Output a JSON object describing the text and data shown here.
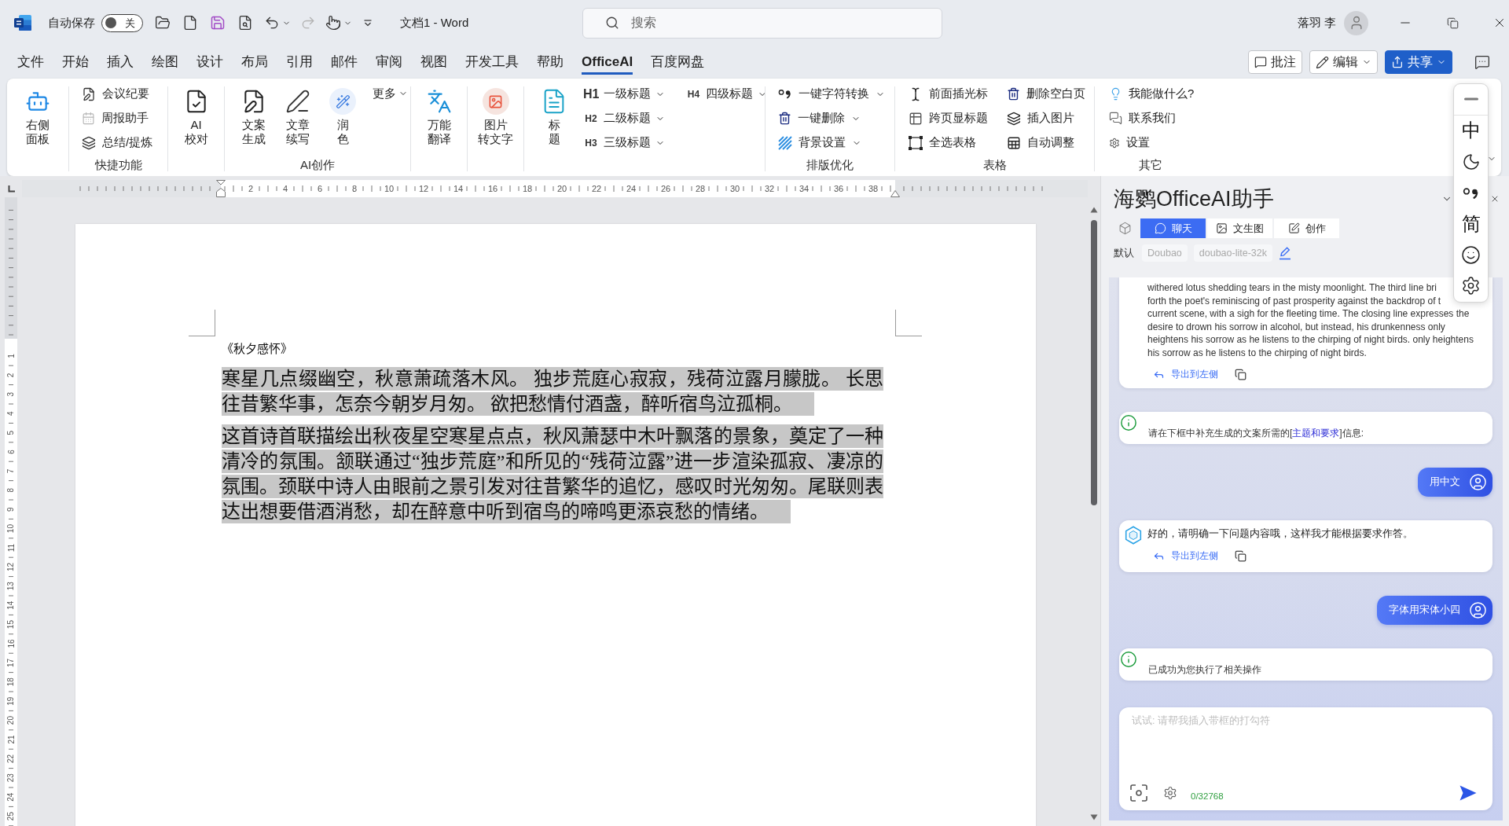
{
  "title_bar": {
    "autosave": {
      "label": "自动保存",
      "on": false,
      "state_label": "关"
    },
    "redo": {
      "disabled": true
    },
    "document_title": "文档1 - Word",
    "search": {
      "placeholder": "搜索"
    },
    "user_name": "落羽 李"
  },
  "tabs": [
    {
      "label": "文件",
      "selected": false
    },
    {
      "label": "开始",
      "selected": false
    },
    {
      "label": "插入",
      "selected": false
    },
    {
      "label": "绘图",
      "selected": false
    },
    {
      "label": "设计",
      "selected": false
    },
    {
      "label": "布局",
      "selected": false
    },
    {
      "label": "引用",
      "selected": false
    },
    {
      "label": "邮件",
      "selected": false
    },
    {
      "label": "审阅",
      "selected": false
    },
    {
      "label": "视图",
      "selected": false
    },
    {
      "label": "开发工具",
      "selected": false
    },
    {
      "label": "帮助",
      "selected": false
    },
    {
      "label": "OfficeAI",
      "selected": true
    },
    {
      "label": "百度网盘",
      "selected": false
    }
  ],
  "tab_actions": [
    {
      "kind": "comment",
      "label": "批注"
    },
    {
      "kind": "edit",
      "label": "编辑"
    },
    {
      "kind": "share",
      "label": "共享"
    }
  ],
  "ribbon": {
    "groups": [
      {
        "items": [
          {
            "kind": "large",
            "lines": [
              "右侧",
              "面板"
            ]
          }
        ]
      },
      {
        "label": "快捷功能",
        "items": [
          {
            "kind": "small",
            "label": "会议纪要"
          },
          {
            "kind": "small",
            "label": "周报助手"
          },
          {
            "kind": "small",
            "label": "总结/提炼"
          }
        ]
      },
      {
        "items": [
          {
            "kind": "large",
            "lines": [
              "AI",
              "校对"
            ]
          }
        ]
      },
      {
        "label": "AI创作",
        "items": [
          {
            "kind": "large",
            "lines": [
              "文案",
              "生成"
            ]
          },
          {
            "kind": "large",
            "lines": [
              "文章",
              "续写"
            ]
          },
          {
            "kind": "large",
            "lines": [
              "润",
              "色"
            ]
          },
          {
            "kind": "menu",
            "label": "更多"
          }
        ]
      },
      {
        "items": [
          {
            "kind": "large",
            "lines": [
              "万能",
              "翻译"
            ]
          }
        ]
      },
      {
        "items": [
          {
            "kind": "large",
            "lines": [
              "图片",
              "转文字"
            ]
          }
        ]
      },
      {
        "items": [
          {
            "kind": "large",
            "lines": [
              "标",
              "题"
            ]
          },
          {
            "kind": "heading",
            "prefix": "H1",
            "label": "一级标题"
          },
          {
            "kind": "heading",
            "prefix": "H2",
            "label": "二级标题"
          },
          {
            "kind": "heading",
            "prefix": "H3",
            "label": "三级标题"
          },
          {
            "kind": "heading",
            "prefix": "H4",
            "label": "四级标题"
          }
        ]
      },
      {
        "label": "排版优化",
        "items": [
          {
            "kind": "dropdown",
            "label": "一键字符转换"
          },
          {
            "kind": "dropdown",
            "label": "一键删除"
          },
          {
            "kind": "dropdown",
            "label": "背景设置"
          }
        ]
      },
      {
        "label": "表格",
        "items": [
          {
            "kind": "small",
            "label": "前面插光标"
          },
          {
            "kind": "small",
            "label": "跨页显标题"
          },
          {
            "kind": "small",
            "label": "全选表格"
          },
          {
            "kind": "small",
            "label": "删除空白页"
          },
          {
            "kind": "small",
            "label": "插入图片"
          },
          {
            "kind": "small",
            "label": "自动调整"
          }
        ]
      },
      {
        "label": "其它",
        "items": [
          {
            "kind": "small",
            "label": "我能做什么?"
          },
          {
            "kind": "small",
            "label": "联系我们"
          },
          {
            "kind": "small",
            "label": "设置"
          }
        ]
      }
    ]
  },
  "ruler": {
    "labels": [
      "2",
      "4",
      "6",
      "8",
      "10",
      "12",
      "14",
      "16",
      "18",
      "20",
      "22",
      "24",
      "26",
      "28",
      "30",
      "32",
      "34",
      "36",
      "38"
    ]
  },
  "vertical_ruler": {
    "labels": [
      "1",
      "2",
      "3",
      "4",
      "5",
      "6",
      "7",
      "8",
      "9",
      "10",
      "11",
      "12",
      "13",
      "14",
      "15",
      "16",
      "17",
      "18",
      "19",
      "20",
      "21",
      "22",
      "23",
      "24",
      "25"
    ]
  },
  "document": {
    "title": "《秋夕感怀》",
    "paragraphs": [
      {
        "text": "寒星几点缀幽空，秋意萧疏落木风。 独步荒庭心寂寂，残荷泣露月朦胧。 长思往昔繁华事，怎奈今朝岁月匆。 欲把愁情付酒盏，醉听宿鸟泣孤桐。",
        "selected": true
      },
      {
        "text": "这首诗首联描绘出秋夜星空寒星点点，秋风萧瑟中木叶飘落的景象，奠定了一种清冷的氛围。颔联通过“独步荒庭”和所见的“残荷泣露”进一步渲染孤寂、凄凉的氛围。颈联中诗人由眼前之景引发对往昔繁华的追忆，感叹时光匆匆。尾联则表达出想要借酒消愁，却在醉意中听到宿鸟的啼鸣更添哀愁的情绪。",
        "selected": true
      }
    ]
  },
  "assistant_panel": {
    "title": "海鹦OfficeAI助手",
    "tabs": [
      {
        "label": "聊天",
        "selected": true
      },
      {
        "label": "文生图",
        "selected": false
      },
      {
        "label": "创作",
        "selected": false
      }
    ],
    "model": {
      "label": "默认",
      "chips": [
        "Doubao",
        "doubao-lite-32k"
      ]
    },
    "messages": [
      {
        "kind": "answer-continued",
        "lines": [
          "withered lotus shedding tears in the misty moonlight. The third line bri",
          "forth the poet's reminiscing of past prosperity against the backdrop of t",
          "current scene, with a sigh for the fleeting time. The closing line expresses the",
          "desire to drown his sorrow in alcohol, but instead, his drunkenness only",
          "heightens his sorrow as he listens to the chirping of night birds. only heightens",
          "his sorrow as he listens to the chirping of night birds."
        ],
        "export_label": "导出到左侧"
      },
      {
        "kind": "info",
        "parts": [
          {
            "kind": "text",
            "text": "请在下框中补充生成的文案所需的["
          },
          {
            "kind": "link",
            "text": "主题和要求"
          },
          {
            "kind": "text",
            "text": "]信息:"
          }
        ]
      },
      {
        "kind": "user",
        "text": "用中文"
      },
      {
        "kind": "answer",
        "text": "好的，请明确一下问题内容哦，这样我才能根据要求作答。",
        "export_label": "导出到左侧"
      },
      {
        "kind": "user",
        "text": "字体用宋体小四"
      },
      {
        "kind": "info",
        "parts": [
          {
            "kind": "text",
            "text": "已成功为您执行了相关操作"
          }
        ]
      }
    ],
    "input": {
      "placeholder": "试试: 请帮我插入带框的打勾符",
      "counter": "0/32768"
    }
  },
  "ime_toolbar": {
    "mode_label": "中",
    "script_label": "简"
  }
}
